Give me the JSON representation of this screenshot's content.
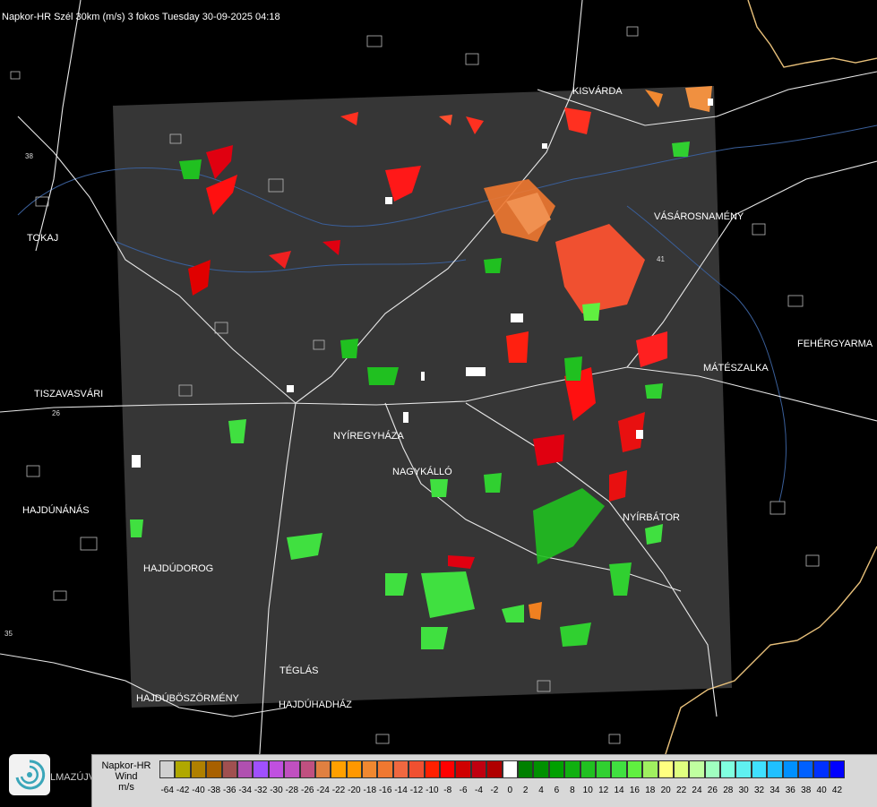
{
  "title": "Napkor-HR Szél 30km (m/s) 3 fokos Tuesday 30-09-2025 04:18",
  "cities": [
    {
      "name": "KISVÁRDA"
    },
    {
      "name": "TOKAJ"
    },
    {
      "name": "VÁSÁROSNAMÉNY"
    },
    {
      "name": "FEHÉRGYARMA"
    },
    {
      "name": "MÁTÉSZALKA"
    },
    {
      "name": "TISZAVASVÁRI"
    },
    {
      "name": "NYÍREGYHÁZA"
    },
    {
      "name": "NAGYKÁLLÓ"
    },
    {
      "name": "HAJDÚNÁNÁS"
    },
    {
      "name": "NYÍRBÁTOR"
    },
    {
      "name": "HAJDÚDOROG"
    },
    {
      "name": "TÉGLÁS"
    },
    {
      "name": "HAJDÚBÖSZÖRMÉNY"
    },
    {
      "name": "HAJDÚHADHÁZ"
    }
  ],
  "road_labels": [
    "38",
    "26",
    "41",
    "35"
  ],
  "legend": {
    "title_lines": [
      "Napkor-HR",
      "Wind",
      "m/s"
    ],
    "ticks": [
      "-64",
      "-42",
      "-40",
      "-38",
      "-36",
      "-34",
      "-32",
      "-30",
      "-28",
      "-26",
      "-24",
      "-22",
      "-20",
      "-18",
      "-16",
      "-14",
      "-12",
      "-10",
      "-8",
      "-6",
      "-4",
      "-2",
      "0",
      "2",
      "4",
      "6",
      "8",
      "10",
      "12",
      "14",
      "16",
      "18",
      "20",
      "22",
      "24",
      "26",
      "28",
      "30",
      "32",
      "34",
      "36",
      "38",
      "40",
      "42"
    ],
    "colors": [
      "#d0d0d0",
      "#b0a800",
      "#b08000",
      "#a86000",
      "#a05050",
      "#b050b0",
      "#a050ff",
      "#c050e0",
      "#c050c0",
      "#c05080",
      "#e08040",
      "#ffa000",
      "#ff9800",
      "#f08830",
      "#f07830",
      "#f06840",
      "#f05030",
      "#ff2000",
      "#ff0000",
      "#d00000",
      "#c00010",
      "#b00000",
      "#ffffff",
      "#008000",
      "#009000",
      "#00a000",
      "#10b010",
      "#20c020",
      "#30d030",
      "#40e040",
      "#60f040",
      "#a0f060",
      "#ffff80",
      "#e0ff80",
      "#c0ffa0",
      "#a0ffc0",
      "#80ffe0",
      "#60f0f0",
      "#40e0ff",
      "#20c0ff",
      "#0090ff",
      "#0060ff",
      "#0030ff",
      "#0000ff"
    ]
  },
  "logo_text": "LMAZÚJVÁR"
}
